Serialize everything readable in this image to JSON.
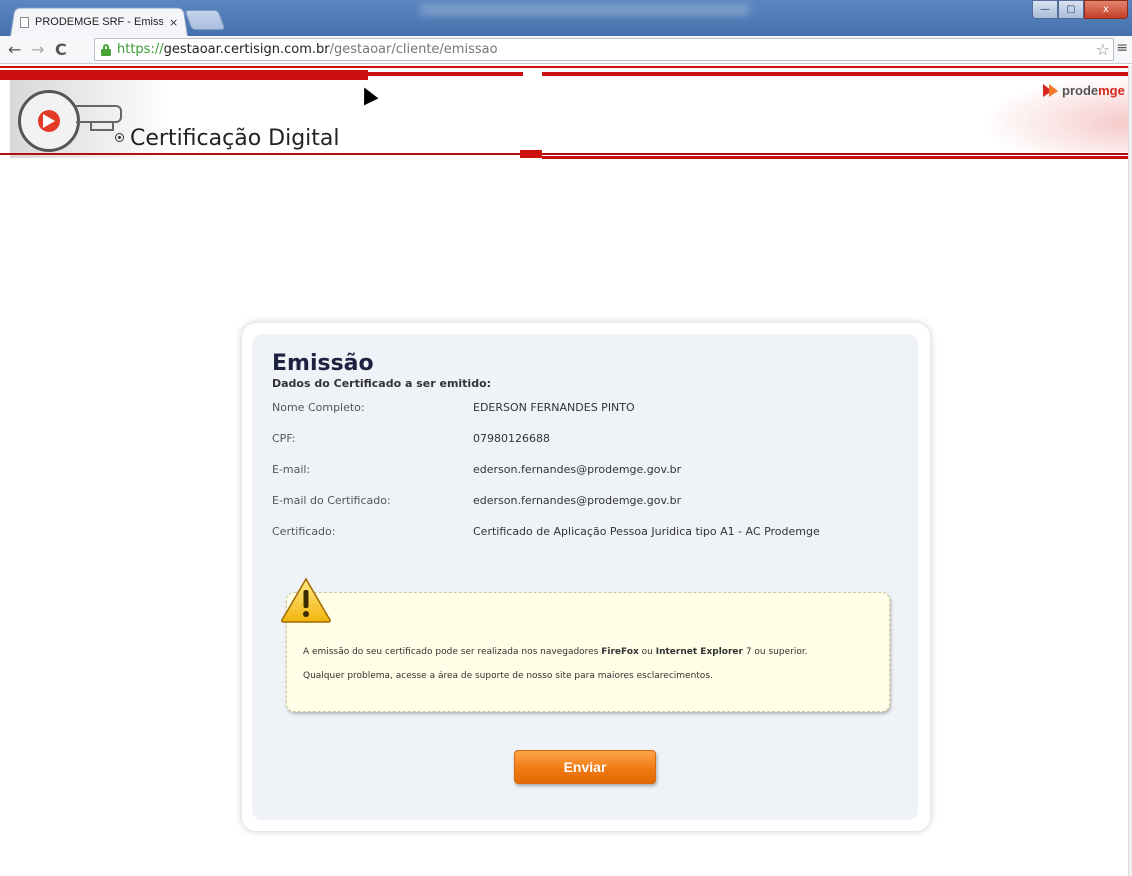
{
  "browser": {
    "tab_title": "PRODEMGE SRF - Emissão",
    "tab_close": "×",
    "url_scheme": "https://",
    "url_host": "gestaoar.certisign.com.br",
    "url_path": "/gestaoar/cliente/emissao",
    "back": "←",
    "forward": "→",
    "reload": "C",
    "star": "☆",
    "menu": "≡",
    "win_min": "—",
    "win_max": "▢",
    "win_close": "x"
  },
  "header": {
    "title": "Certificação Digital",
    "brand_prefix": "prode",
    "brand_suffix": "mge",
    "seal_text": "CERTIFICAÇÃO DIGITAL",
    "brand_color": "#d7261d"
  },
  "form": {
    "title": "Emissão",
    "subtitle": "Dados do Certificado a ser emitido:",
    "fields": [
      {
        "label": "Nome Completo:",
        "value": "EDERSON FERNANDES PINTO"
      },
      {
        "label": "CPF:",
        "value": "07980126688"
      },
      {
        "label": "E-mail:",
        "value": "ederson.fernandes@prodemge.gov.br"
      },
      {
        "label": "E-mail do Certificado:",
        "value": "ederson.fernandes@prodemge.gov.br"
      },
      {
        "label": "Certificado:",
        "value": "Certificado de Aplicação Pessoa Juridica tipo A1 - AC Prodemge"
      }
    ]
  },
  "warning": {
    "line1_pre": "A emissão do seu certificado pode ser realizada nos navegadores ",
    "browser1": "FireFox",
    "line1_mid": " ou ",
    "browser2": "Internet Explorer",
    "line1_post": " 7 ou superior.",
    "line2": "Qualquer problema, acesse a área de suporte de nosso site para maiores esclarecimentos.",
    "icon": "warning-icon"
  },
  "actions": {
    "submit_label": "Enviar",
    "submit_color": "#f07a12"
  }
}
